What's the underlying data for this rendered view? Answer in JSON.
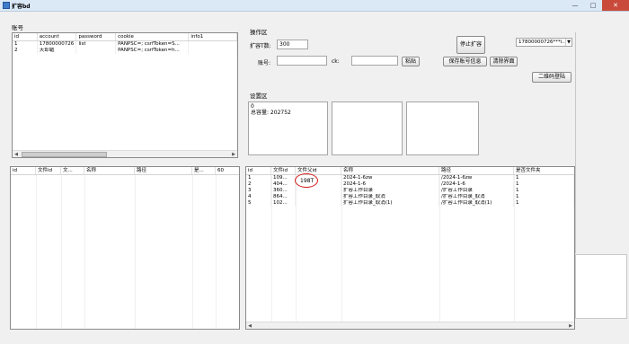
{
  "window": {
    "title": "扩容bd"
  },
  "account_section": {
    "label": "账号",
    "columns": [
      "id",
      "account",
      "password",
      "cookie",
      "info1"
    ],
    "rows": [
      [
        "1",
        "17800000726",
        "list",
        "PANPSC=; csrfToken=S...",
        ""
      ],
      [
        "2",
        "天却霜",
        "",
        "PANPSC=; csrfToken=h...",
        ""
      ]
    ]
  },
  "operation_section": {
    "label": "操作区",
    "expand_label": "扩容T数:",
    "expand_value": "300",
    "account_label": "账号:",
    "account_value": "",
    "ck_label": "ck:",
    "ck_value": "",
    "paste_button": "粘贴",
    "stop_button": "停止扩容",
    "save_button": "保存账号信息",
    "clear_button": "清除界面",
    "qrcode_button": "二维码登陆",
    "account_select": "17800000726***i..."
  },
  "settings_section": {
    "label": "设置区",
    "box1_line1": "0",
    "box1_line2": "总容量: 202752"
  },
  "left_file_table": {
    "columns": [
      "id",
      "文件id",
      "文...",
      "名称",
      "路径",
      "是...",
      "60"
    ]
  },
  "right_file_table": {
    "columns": [
      "id",
      "文件id",
      "文件父id",
      "名称",
      "路径",
      "是否文件夹"
    ],
    "rows": [
      [
        "1",
        "109...",
        "",
        "2024-1-6zw",
        "/2024-1-6zw",
        "1"
      ],
      [
        "2",
        "404...",
        "",
        "2024-1-6",
        "/2024-1-6",
        "1"
      ],
      [
        "3",
        "360...",
        "",
        "扩容工作目录",
        "/扩容工作目录",
        "1"
      ],
      [
        "4",
        "864...",
        "",
        "扩容工作目录_取消",
        "/扩容工作目录_取消",
        "1"
      ],
      [
        "5",
        "102...",
        "",
        "扩容工作目录_取消(1)",
        "/扩容工作目录_取消(1)",
        "1"
      ]
    ],
    "highlight_text": "198T"
  },
  "colors": {
    "highlight_circle": "#d51a1a",
    "titlebar": "#dbe8f6"
  }
}
